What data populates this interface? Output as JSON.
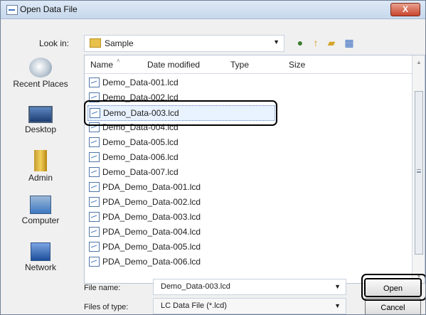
{
  "window": {
    "title": "Open Data File",
    "close_label": "X"
  },
  "lookin": {
    "label": "Look in:",
    "value": "Sample"
  },
  "places": [
    "Recent Places",
    "Desktop",
    "Admin",
    "Computer",
    "Network"
  ],
  "columns": [
    "Name",
    "Date modified",
    "Type",
    "Size"
  ],
  "files": [
    "Demo_Data-001.lcd",
    "Demo_Data-002.lcd",
    "Demo_Data-003.lcd",
    "Demo_Data-004.lcd",
    "Demo_Data-005.lcd",
    "Demo_Data-006.lcd",
    "Demo_Data-007.lcd",
    "PDA_Demo_Data-001.lcd",
    "PDA_Demo_Data-002.lcd",
    "PDA_Demo_Data-003.lcd",
    "PDA_Demo_Data-004.lcd",
    "PDA_Demo_Data-005.lcd",
    "PDA_Demo_Data-006.lcd"
  ],
  "selected_file": "Demo_Data-003.lcd",
  "filename": {
    "label": "File name:",
    "value": "Demo_Data-003.lcd"
  },
  "filetype": {
    "label": "Files of type:",
    "value": "LC Data File (*.lcd)"
  },
  "buttons": {
    "open": "Open",
    "cancel": "Cancel"
  }
}
